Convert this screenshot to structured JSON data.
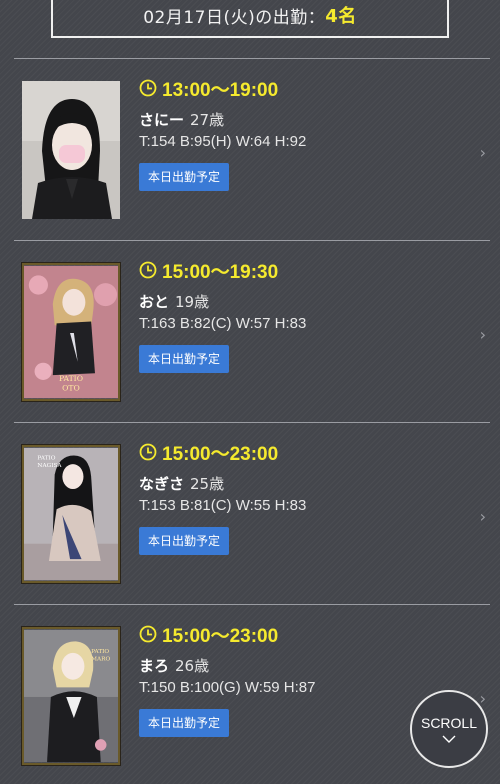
{
  "header": {
    "date_text": "02月17日(火)の出勤：",
    "count": "4名"
  },
  "badge_label": "本日出勤予定",
  "scroll_label": "SCROLL",
  "colors": {
    "accent_yellow": "#f5ea2e",
    "badge_blue": "#3a7ad6",
    "background": "#44464c"
  },
  "cards": [
    {
      "time": "13:00〜19:00",
      "name": "さにー",
      "age": "27歳",
      "stats": "T:154 B:95(H) W:64 H:92"
    },
    {
      "time": "15:00〜19:30",
      "name": "おと",
      "age": "19歳",
      "stats": "T:163 B:82(C) W:57 H:83",
      "photo_caption": "PATIO OTO"
    },
    {
      "time": "15:00〜23:00",
      "name": "なぎさ",
      "age": "25歳",
      "stats": "T:153 B:81(C) W:55 H:83",
      "photo_caption": "PATIO NAGISA"
    },
    {
      "time": "15:00〜23:00",
      "name": "まろ",
      "age": "26歳",
      "stats": "T:150 B:100(G) W:59 H:87",
      "photo_caption": "PATIO MARO"
    }
  ]
}
